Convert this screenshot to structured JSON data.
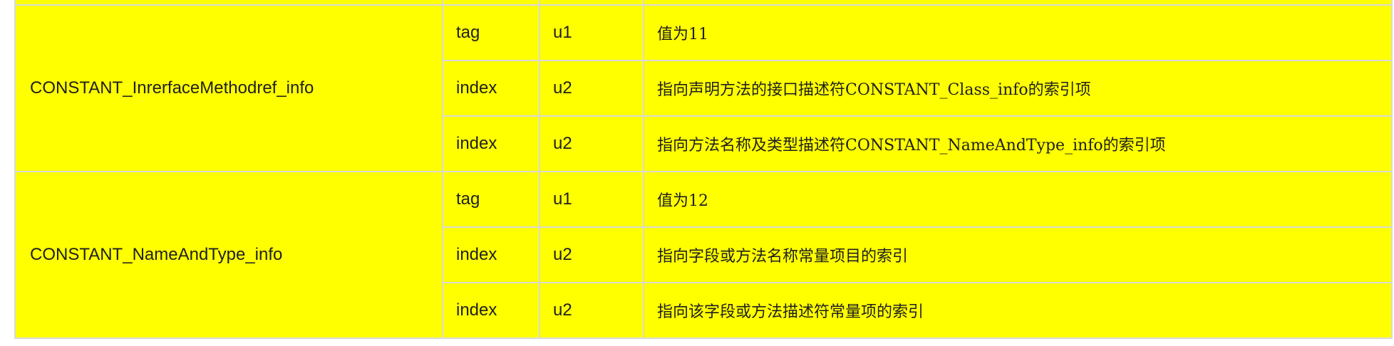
{
  "table": {
    "groups": [
      {
        "name": "CONSTANT_InrerfaceMethodref_info",
        "rows": [
          {
            "item": "tag",
            "type": "u1",
            "desc": "值为11"
          },
          {
            "item": "index",
            "type": "u2",
            "desc": "指向声明方法的接口描述符CONSTANT_Class_info的索引项"
          },
          {
            "item": "index",
            "type": "u2",
            "desc": "指向方法名称及类型描述符CONSTANT_NameAndType_info的索引项"
          }
        ]
      },
      {
        "name": "CONSTANT_NameAndType_info",
        "rows": [
          {
            "item": "tag",
            "type": "u1",
            "desc": "值为12"
          },
          {
            "item": "index",
            "type": "u2",
            "desc": "指向字段或方法名称常量项目的索引"
          },
          {
            "item": "index",
            "type": "u2",
            "desc": "指向该字段或方法描述符常量项的索引"
          }
        ]
      }
    ]
  },
  "colors": {
    "cell_background": "#ffff00",
    "border": "#d9d9d9",
    "text": "#1f1f1f"
  }
}
